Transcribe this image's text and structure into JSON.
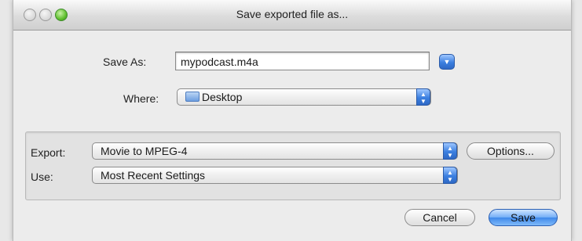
{
  "window": {
    "title": "Save exported file as..."
  },
  "save_as": {
    "label": "Save As:",
    "value": "mypodcast.m4a"
  },
  "where": {
    "label": "Where:",
    "value": "Desktop"
  },
  "export": {
    "label": "Export:",
    "value": "Movie to MPEG-4",
    "options_label": "Options..."
  },
  "use": {
    "label": "Use:",
    "value": "Most Recent Settings"
  },
  "buttons": {
    "cancel": "Cancel",
    "save": "Save"
  },
  "icons": {
    "disclosure": "chevron-down-icon",
    "location": "folder-icon",
    "popup": "up-down-arrows-icon"
  },
  "colors": {
    "accent": "#3b7fe0",
    "window_bg": "#ececec"
  }
}
